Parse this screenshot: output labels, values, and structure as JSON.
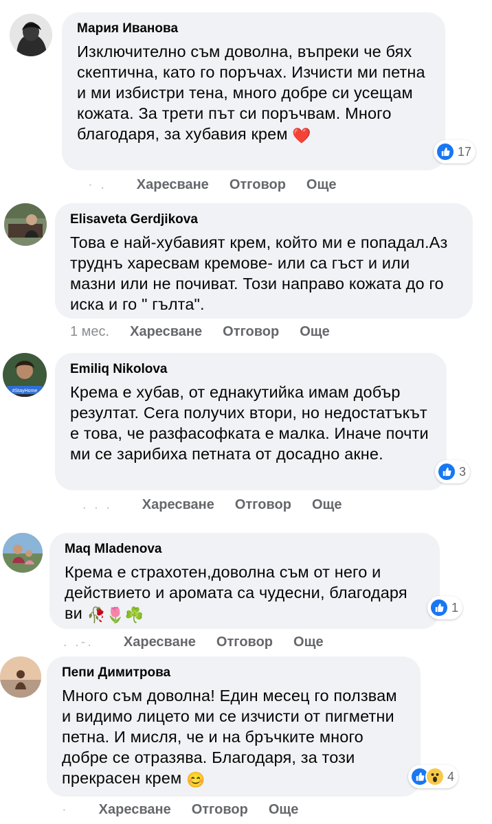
{
  "colors": {
    "bubble": "#f0f2f5",
    "action_text": "#65676b",
    "like_blue": "#1877f2",
    "heart_red": "#e41e3f",
    "wow_yellow": "#f7c94b"
  },
  "actions": {
    "like": "Харесване",
    "reply": "Отговор",
    "more": "Още"
  },
  "comments": [
    {
      "author": "Мария Иванова",
      "text": "Изключително съм доволна, въпреки че бях скептична, като го поръчах. Изчисти ми петна и ми избистри тена, много добре си усещам кожата. За трети път си поръчвам. Много благодаря, за хубавия крем",
      "emoji": "❤️",
      "reaction_count": "17",
      "reactions": [
        "like-icon"
      ]
    },
    {
      "author": "Elisaveta Gerdjikova",
      "text": "Това е най-хубавият крем, който ми е попадал.Аз труднъ харесвам кремове- или са гъст и или мазни или не почиват. Този направо кожата до го иска и го \" гълта\".",
      "time": "1 мес."
    },
    {
      "author": "Emiliq Nikolova",
      "text": "Крема е хубав, от еднакутийка имам добър резултат. Сега получих втори, но недостатъкът е това, че разфасофката е малка. Иначе почти ми се зарибиха петната от досадно акне.",
      "reaction_count": "3",
      "reactions": [
        "like-icon"
      ]
    },
    {
      "author": "Maq Mladenova",
      "text": "Крема е страхотен,доволна съм от него и действието и аромата са чудесни, благодаря ви",
      "emoji": "🥀🌷☘️",
      "reaction_count": "1",
      "reactions": [
        "like-icon"
      ]
    },
    {
      "author": "Пепи Димитрова",
      "text": "Много съм доволна! Един месец го ползвам и видимо лицето ми се изчисти от пигметни петна. И мисля, че и на бръчките много добре се отразява. Благодаря, за този прекрасен крем",
      "emoji": "😊",
      "reaction_count": "4",
      "reactions": [
        "like-icon",
        "wow-icon"
      ]
    }
  ]
}
